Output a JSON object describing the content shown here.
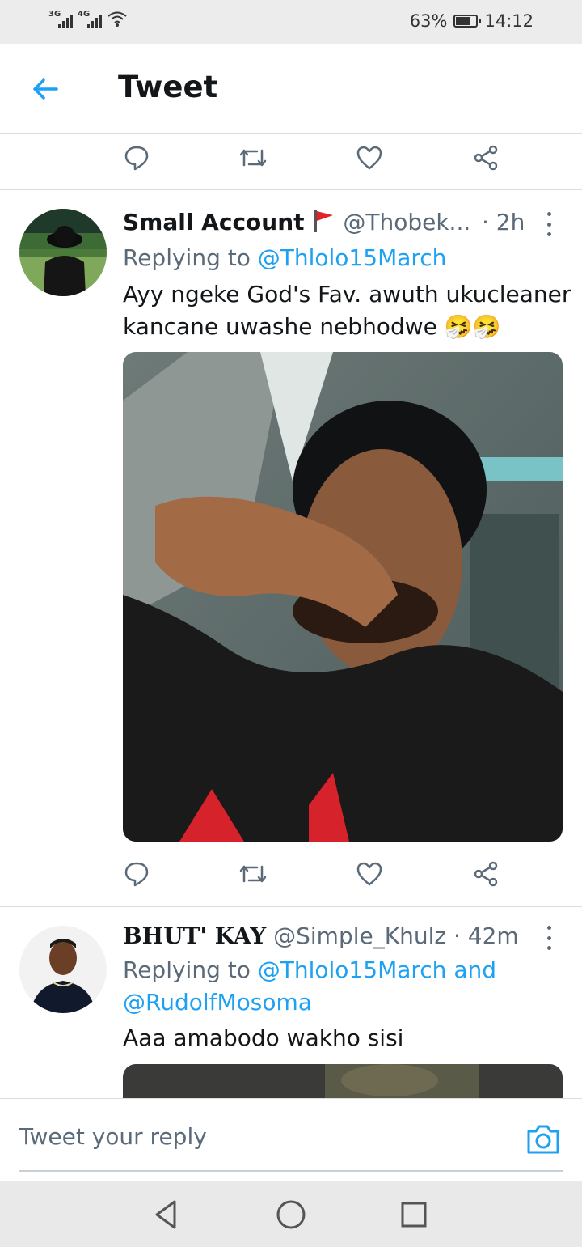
{
  "status_bar": {
    "network_1": "3G",
    "network_2": "4G",
    "battery": "63%",
    "battery_level": 0.63,
    "time": "14:12"
  },
  "header": {
    "title": "Tweet"
  },
  "tweets": [
    {
      "display_name": "Small Account",
      "handle": "@Thobek...",
      "time": "· 2h",
      "replying_prefix": "Replying to ",
      "replying_to": "@Thlolo15March",
      "text_line1": "Ayy ngeke God's Fav. awuth ukucleaner",
      "text_line2": "kancane uwashe nebhodwe",
      "emoji": "🤧🤧"
    },
    {
      "display_name": "BHUT' KAY",
      "handle": "@Simple_Khulz",
      "time": "· 42m",
      "replying_prefix": "Replying to ",
      "replying_to": "@Thlolo15March and",
      "replying_to_2": "@RudolfMosoma",
      "text_line1": "Aaa amabodo wakho sisi"
    }
  ],
  "reply_bar": {
    "placeholder": "Tweet your reply"
  },
  "colors": {
    "accent": "#1da1f2",
    "secondary_text": "#5b6a78",
    "primary_text": "#14171a"
  }
}
